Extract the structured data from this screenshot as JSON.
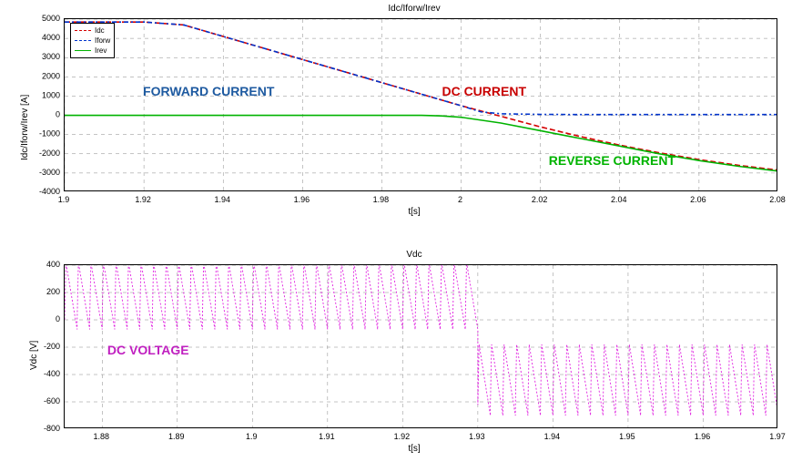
{
  "chart_data": [
    {
      "type": "line",
      "title": "Idc/Iforw/Irev",
      "xlabel": "t[s]",
      "ylabel": "Idc/Iforw/Irev [A]",
      "xlim": [
        1.9,
        2.08
      ],
      "ylim": [
        -4000,
        5000
      ],
      "yticks": [
        -4000,
        -3000,
        -2000,
        -1000,
        0,
        1000,
        2000,
        3000,
        4000,
        5000
      ],
      "xticks": [
        1.9,
        1.92,
        1.94,
        1.96,
        1.98,
        2.0,
        2.02,
        2.04,
        2.06,
        2.08
      ],
      "legend": [
        {
          "name": "Idc",
          "color": "#d40000",
          "dash": "6 3"
        },
        {
          "name": "Iforw",
          "color": "#0033cc",
          "dash": "5 3 2 3"
        },
        {
          "name": "Irev",
          "color": "#00b300",
          "dash": ""
        }
      ],
      "annotations": [
        {
          "text": "FORWARD CURRENT",
          "color": "#1e5aa0",
          "x": 1.925,
          "y": 1300
        },
        {
          "text": "DC CURRENT",
          "color": "#c80000",
          "x": 2.0,
          "y": 1000
        },
        {
          "text": "REVERSE CURRENT",
          "color": "#00b300",
          "x": 2.04,
          "y": -2400
        }
      ],
      "series": [
        {
          "name": "Idc",
          "x": [
            1.9,
            1.91,
            1.92,
            1.93,
            1.94,
            1.95,
            1.96,
            1.97,
            1.98,
            1.99,
            2.0,
            2.01,
            2.02,
            2.03,
            2.04,
            2.05,
            2.06,
            2.07,
            2.08
          ],
          "values": [
            4850,
            4850,
            4850,
            4700,
            4100,
            3500,
            2900,
            2300,
            1700,
            1100,
            500,
            -50,
            -600,
            -1100,
            -1550,
            -1950,
            -2300,
            -2600,
            -2850
          ]
        },
        {
          "name": "Iforw",
          "x": [
            1.9,
            1.91,
            1.92,
            1.93,
            1.94,
            1.95,
            1.96,
            1.97,
            1.98,
            1.99,
            2.0,
            2.005,
            2.01,
            2.02,
            2.03,
            2.04,
            2.05,
            2.06,
            2.07,
            2.08
          ],
          "values": [
            4850,
            4850,
            4850,
            4700,
            4100,
            3500,
            2900,
            2300,
            1700,
            1100,
            500,
            180,
            80,
            50,
            40,
            40,
            40,
            40,
            40,
            40
          ]
        },
        {
          "name": "Irev",
          "x": [
            1.9,
            1.95,
            1.99,
            1.995,
            2.0,
            2.01,
            2.02,
            2.03,
            2.04,
            2.05,
            2.06,
            2.07,
            2.08
          ],
          "values": [
            0,
            0,
            0,
            -30,
            -100,
            -400,
            -800,
            -1200,
            -1600,
            -2000,
            -2350,
            -2650,
            -2900
          ]
        }
      ]
    },
    {
      "type": "line",
      "title": "Vdc",
      "xlabel": "t[s]",
      "ylabel": "Vdc [V]",
      "xlim": [
        1.875,
        1.97
      ],
      "ylim": [
        -800,
        400
      ],
      "yticks": [
        -800,
        -600,
        -400,
        -200,
        0,
        200,
        400
      ],
      "xticks": [
        1.88,
        1.89,
        1.9,
        1.91,
        1.92,
        1.93,
        1.94,
        1.95,
        1.96,
        1.97
      ],
      "legend": [
        {
          "name": "Vdc",
          "color": "#e020e0",
          "dash": "2 2"
        }
      ],
      "annotations": [
        {
          "text": "DC VOLTAGE",
          "color": "#c020c0",
          "x": 1.885,
          "y": -200
        }
      ],
      "series": [
        {
          "name": "Vdc",
          "note": "six-pulse ripple; mean ≈ +210V for t<1.93s, step to mean ≈ -440V for t>1.93s; peak-to-peak ≈ 500V",
          "segments": [
            {
              "t_from": 1.875,
              "t_to": 1.93,
              "mean": 210,
              "min": -70,
              "max": 420,
              "ripple_periods": 33
            },
            {
              "t_from": 1.93,
              "t_to": 1.97,
              "mean": -440,
              "min": -700,
              "max": -180,
              "ripple_periods": 24
            }
          ]
        }
      ]
    }
  ]
}
